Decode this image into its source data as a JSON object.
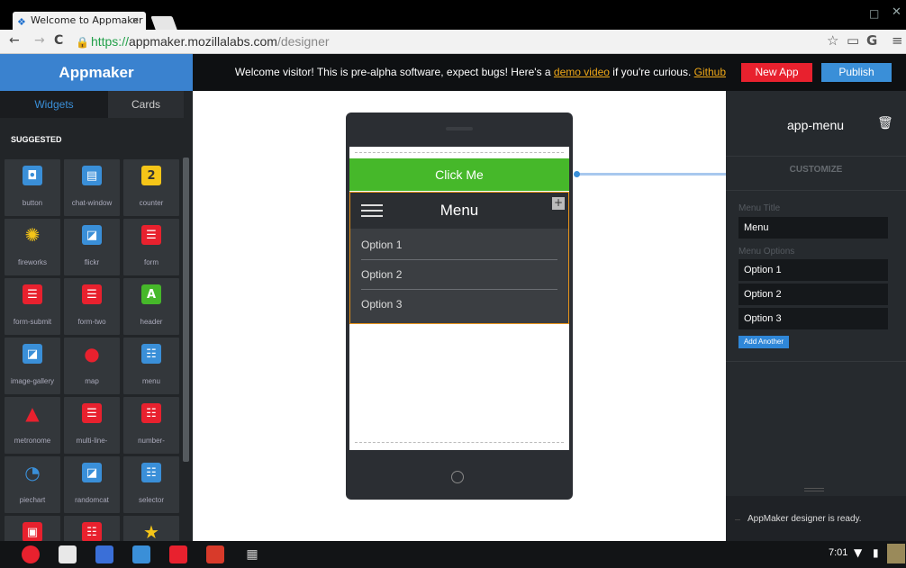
{
  "browser": {
    "tab_title": "Welcome to Appmaker",
    "tab_close": "×",
    "url_scheme": "https://",
    "url_host": "appmaker.mozillalabs.com",
    "url_path": "/designer"
  },
  "header": {
    "brand": "Appmaker",
    "welcome_text": "Welcome visitor! This is pre-alpha software, expect bugs! Here's a ",
    "demo_link": "demo video",
    "welcome_mid": " if you're curious. ",
    "github_link": "Github",
    "new_app_label": "New App",
    "publish_label": "Publish"
  },
  "sidebar": {
    "tabs": [
      "Widgets",
      "Cards"
    ],
    "section_label": "SUGGESTED",
    "widgets": [
      {
        "label": "button",
        "icon": "button-icon",
        "color": "#3a8fd8"
      },
      {
        "label": "chat-window",
        "icon": "chat-icon",
        "color": "#3a8fd8"
      },
      {
        "label": "counter",
        "icon": "counter-icon",
        "color": "#f5c518"
      },
      {
        "label": "fireworks",
        "icon": "fireworks-icon",
        "color": "#f5c518"
      },
      {
        "label": "flickr",
        "icon": "image-icon",
        "color": "#3a8fd8"
      },
      {
        "label": "form",
        "icon": "form-icon",
        "color": "#e8212e"
      },
      {
        "label": "form-submit",
        "icon": "form-icon",
        "color": "#e8212e"
      },
      {
        "label": "form-two",
        "icon": "form-icon",
        "color": "#e8212e"
      },
      {
        "label": "header",
        "icon": "header-icon",
        "color": "#46b82a"
      },
      {
        "label": "image-gallery",
        "icon": "image-icon",
        "color": "#3a8fd8"
      },
      {
        "label": "map",
        "icon": "map-pin-icon",
        "color": "#e8212e"
      },
      {
        "label": "menu",
        "icon": "menu-icon",
        "color": "#3a8fd8"
      },
      {
        "label": "metronome",
        "icon": "metronome-icon",
        "color": "#e8212e"
      },
      {
        "label": "multi-line-",
        "icon": "form-icon",
        "color": "#e8212e"
      },
      {
        "label": "number-",
        "icon": "number-icon",
        "color": "#e8212e"
      },
      {
        "label": "piechart",
        "icon": "piechart-icon",
        "color": "#3a8fd8"
      },
      {
        "label": "randomcat",
        "icon": "image-icon",
        "color": "#3a8fd8"
      },
      {
        "label": "selector",
        "icon": "menu-icon",
        "color": "#3a8fd8"
      },
      {
        "label": "",
        "icon": "camera-icon",
        "color": "#e8212e"
      },
      {
        "label": "",
        "icon": "number-icon",
        "color": "#e8212e"
      },
      {
        "label": "",
        "icon": "star-icon",
        "color": "#f5c518"
      }
    ]
  },
  "preview": {
    "click_me": "Click Me",
    "menu_title": "Menu",
    "menu_plus": "+",
    "options": [
      "Option 1",
      "Option 2",
      "Option 3"
    ]
  },
  "panel": {
    "title": "app-menu",
    "customize": "CUSTOMIZE",
    "menu_title_label": "Menu Title",
    "menu_title_value": "Menu",
    "menu_options_label": "Menu Options",
    "options": [
      "Option 1",
      "Option 2",
      "Option 3"
    ],
    "add_another": "Add Another",
    "status": "AppMaker designer is ready."
  },
  "shelf": {
    "clock": "7:01",
    "apps": [
      {
        "name": "chrome-icon",
        "color": "#e8212e"
      },
      {
        "name": "gmail-icon",
        "color": "#e8e8e8"
      },
      {
        "name": "google-search-icon",
        "color": "#3a6fd8"
      },
      {
        "name": "docs-icon",
        "color": "#3a8fd8"
      },
      {
        "name": "youtube-icon",
        "color": "#e8212e"
      },
      {
        "name": "angry-birds-icon",
        "color": "#d83a2a"
      },
      {
        "name": "app-launcher-icon",
        "color": "#121416"
      }
    ]
  }
}
